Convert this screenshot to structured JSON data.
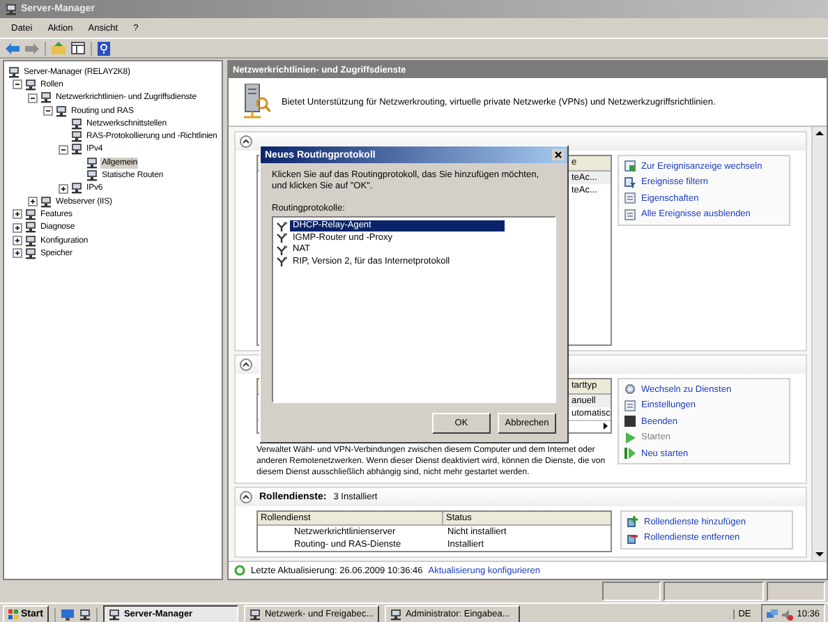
{
  "window": {
    "title": "Server-Manager"
  },
  "menu": [
    "Datei",
    "Aktion",
    "Ansicht",
    "?"
  ],
  "tree": [
    {
      "label": "Server-Manager (RELAY2K8)",
      "selected": false,
      "children": [
        {
          "label": "Rollen",
          "selected": false,
          "expanded": true,
          "children": [
            {
              "label": "Netzwerkrichtlinien- und Zugriffsdienste",
              "selected": false,
              "expanded": true,
              "children": [
                {
                  "label": "Routing und RAS",
                  "selected": false,
                  "expanded": true,
                  "children": [
                    {
                      "label": "Netzwerkschnittstellen",
                      "selected": false
                    },
                    {
                      "label": "RAS-Protokollierung und -Richtlinien",
                      "selected": false
                    },
                    {
                      "label": "IPv4",
                      "selected": false,
                      "expanded": true,
                      "children": [
                        {
                          "label": "Allgemein",
                          "selected": true
                        },
                        {
                          "label": "Statische Routen",
                          "selected": false
                        }
                      ]
                    },
                    {
                      "label": "IPv6",
                      "selected": false,
                      "expanded": false
                    }
                  ]
                }
              ]
            },
            {
              "label": "Webserver (IIS)",
              "selected": false,
              "expanded": false
            }
          ]
        },
        {
          "label": "Features",
          "selected": false,
          "expanded": false
        },
        {
          "label": "Diagnose",
          "selected": false,
          "expanded": false
        },
        {
          "label": "Konfiguration",
          "selected": false,
          "expanded": false
        },
        {
          "label": "Speicher",
          "selected": false,
          "expanded": false
        }
      ]
    }
  ],
  "pane": {
    "title": "Netzwerkrichtlinien- und Zugriffsdienste",
    "description": "Bietet Unterstützung für Netzwerkrouting, virtuelle private Netzwerke (VPNs) und Netzwerkzugriffsrichtlinien.",
    "sections": [
      {
        "expanded": true,
        "table": {
          "columns": [
            "e"
          ],
          "rows": [
            [
              "teAc..."
            ],
            [
              "teAc..."
            ]
          ]
        },
        "actions": [
          {
            "label": "Zur Ereignisanzeige wechseln",
            "kind": "viewer",
            "disabled": false
          },
          {
            "label": "Ereignisse filtern",
            "kind": "filter",
            "disabled": false
          },
          {
            "label": "Eigenschaften",
            "kind": "page",
            "disabled": false
          },
          {
            "label": "Alle Ereignisse ausblenden",
            "kind": "page",
            "disabled": false
          }
        ]
      },
      {
        "expanded": true,
        "table": {
          "columns": [
            "tarttyp"
          ],
          "rows": [
            [
              "anuell"
            ],
            [
              "utomatisc"
            ]
          ]
        },
        "actions": [
          {
            "label": "Wechseln zu Diensten",
            "kind": "gears",
            "disabled": false
          },
          {
            "label": "Einstellungen",
            "kind": "page",
            "disabled": false
          },
          {
            "label": "Beenden",
            "kind": "stop",
            "disabled": false
          },
          {
            "label": "Starten",
            "kind": "start",
            "disabled": true
          },
          {
            "label": "Neu starten",
            "kind": "restart",
            "disabled": false
          }
        ],
        "description": "Verwaltet Wähl- und VPN-Verbindungen zwischen diesem Computer und dem Internet oder anderen Remotenetzwerken. Wenn dieser Dienst deaktiviert wird, können die Dienste, die von diesem Dienst ausschließlich abhängig sind, nicht mehr gestartet werden."
      },
      {
        "expanded": true,
        "title": "Rollendienste:",
        "summary": "3 Installiert",
        "table": {
          "columns": [
            "Rollendienst",
            "Status"
          ],
          "rows": [
            [
              "Netzwerkrichtlinienserver",
              "Nicht installiert"
            ],
            [
              "Routing- und RAS-Dienste",
              "Installiert"
            ]
          ]
        },
        "actions": [
          {
            "label": "Rollendienste hinzufügen",
            "kind": "add",
            "disabled": false
          },
          {
            "label": "Rollendienste entfernen",
            "kind": "remove",
            "disabled": false
          }
        ]
      }
    ],
    "last_update": "Letzte Aktualisierung: 26.06.2009 10:36:46",
    "update_link": "Aktualisierung konfigurieren"
  },
  "dialog": {
    "title": "Neues Routingprotokoll",
    "instruction": "Klicken Sie auf das Routingprotokoll, das Sie hinzufügen möchten, und klicken Sie auf \"OK\".",
    "list_label": "Routingprotokolle:",
    "items": [
      {
        "label": "DHCP-Relay-Agent",
        "selected": true
      },
      {
        "label": "IGMP-Router und -Proxy",
        "selected": false
      },
      {
        "label": "NAT",
        "selected": false
      },
      {
        "label": "RIP, Version 2, für das Internetprotokoll",
        "selected": false
      }
    ],
    "buttons": [
      "OK",
      "Abbrechen"
    ]
  },
  "taskbar": {
    "start": "Start",
    "tasks": [
      {
        "label": "Server-Manager",
        "selected": true
      },
      {
        "label": "Netzwerk- und Freigabec...",
        "selected": false
      },
      {
        "label": "Administrator: Eingabea...",
        "selected": false
      }
    ],
    "language": "DE",
    "clock": "10:36"
  }
}
